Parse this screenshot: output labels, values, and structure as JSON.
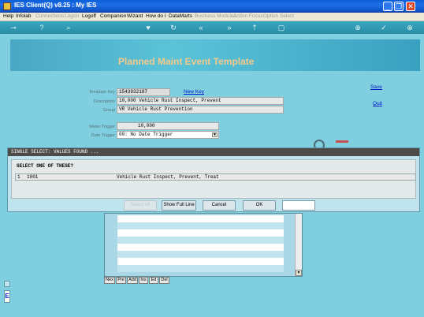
{
  "window": {
    "title": "IES Client(Q) v8.25 : My IES",
    "minimize": "_",
    "restore": "❐",
    "close": "✕"
  },
  "menu": [
    {
      "label": "Help",
      "enabled": true
    },
    {
      "label": "Infolab",
      "enabled": true
    },
    {
      "label": "Connections",
      "enabled": false
    },
    {
      "label": "Logon",
      "enabled": false
    },
    {
      "label": "Logoff",
      "enabled": true
    },
    {
      "label": "Companion",
      "enabled": true
    },
    {
      "label": "Wizard",
      "enabled": true
    },
    {
      "label": "How do I",
      "enabled": true
    },
    {
      "label": "DataMarts",
      "enabled": true
    },
    {
      "label": "Business Modules",
      "enabled": false
    },
    {
      "label": "Action Focus",
      "enabled": false
    },
    {
      "label": "Option Select",
      "enabled": false
    }
  ],
  "toolbar_icons": [
    "key-icon",
    "help-icon",
    "search-icon",
    "heart-icon",
    "refresh-icon",
    "rewind-icon",
    "fast-forward-icon",
    "upload-icon",
    "page-icon",
    "add-icon",
    "ok-icon",
    "close-icon"
  ],
  "page": {
    "title": "Planned Maint Event Template",
    "save": "Save",
    "quit": "Quit",
    "new_key": "New Key"
  },
  "form": {
    "template_key": {
      "label": "Template Key",
      "value": "1543932187"
    },
    "description": {
      "label": "Description",
      "value": "10,000 Vehicle Rust Inspect, Prevent"
    },
    "group": {
      "label": "Group",
      "value": "VR Vehicle Rust Prevention"
    },
    "meter_trigger": {
      "label": "Meter Trigger",
      "value": "10,000"
    },
    "date_trigger": {
      "label": "Date Trigger",
      "value": "00: No Date Trigger"
    }
  },
  "dialog": {
    "title": "SINGLE SELECT: VALUES FOUND  ...",
    "prompt": "SELECT ONE OF THESE?",
    "rows": [
      {
        "num": "1",
        "code": "1001",
        "text": "Vehicle Rust Inspect, Prevent, Treat"
      }
    ],
    "buttons": {
      "select_all": "Select All",
      "show_full_line": "Show Full Line",
      "cancel": "Cancel",
      "ok": "OK"
    }
  },
  "nav_buttons": [
    "Nex",
    "Pre",
    "Add",
    "Ins",
    "Ed",
    "Del"
  ],
  "left_edge_glyph": "E",
  "colors": {
    "title_bar": "#0a5fd8",
    "background": "#7fcfe0",
    "page_title": "#f4c98c",
    "dialog_title_bar": "#4d4b47",
    "link": "#0018c8"
  }
}
